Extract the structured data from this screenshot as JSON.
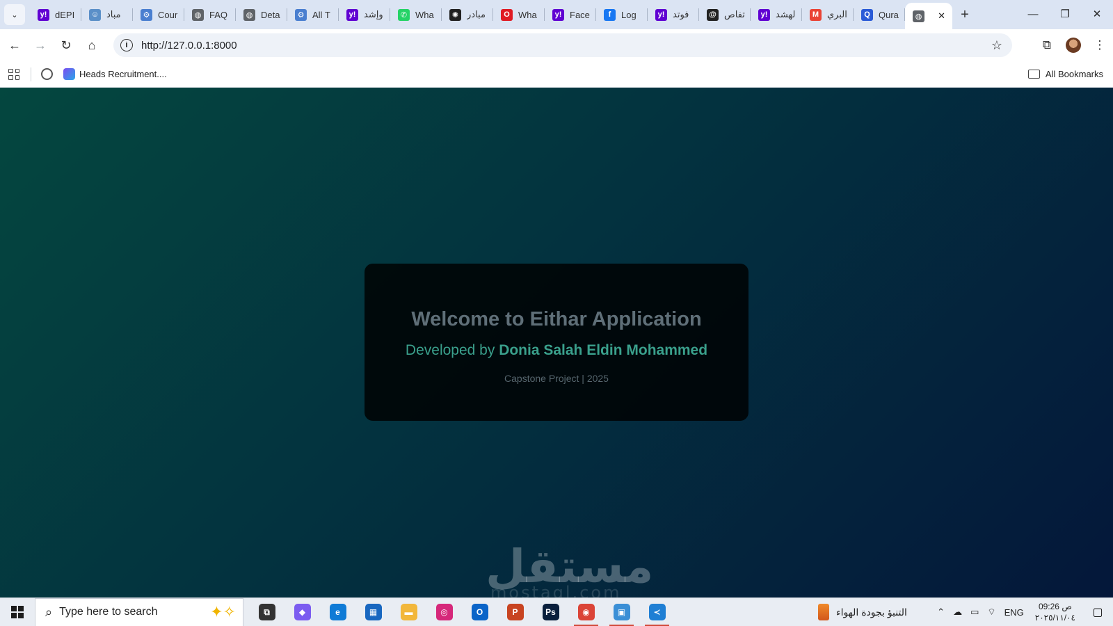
{
  "browser": {
    "tabs": [
      {
        "title": "dEPI",
        "icon": "yahoo-icon",
        "color": "#6001d2",
        "glyph": "y!"
      },
      {
        "title": "مباد",
        "icon": "person-icon",
        "color": "#5a8fc8",
        "glyph": "☺"
      },
      {
        "title": "Cour",
        "icon": "course-icon",
        "color": "#4a7fd0",
        "glyph": "⚙"
      },
      {
        "title": "FAQ",
        "icon": "globe-icon",
        "color": "#5f6368",
        "glyph": "◍"
      },
      {
        "title": "Deta",
        "icon": "globe-icon",
        "color": "#5f6368",
        "glyph": "◍"
      },
      {
        "title": "All T",
        "icon": "course-icon",
        "color": "#4a7fd0",
        "glyph": "⚙"
      },
      {
        "title": "وإشد",
        "icon": "yahoo-icon",
        "color": "#6001d2",
        "glyph": "y!"
      },
      {
        "title": "Wha",
        "icon": "whatsapp-icon",
        "color": "#25d366",
        "glyph": "✆"
      },
      {
        "title": "مبادر",
        "icon": "openai-icon",
        "color": "#222222",
        "glyph": "✺"
      },
      {
        "title": "Wha",
        "icon": "opera-icon",
        "color": "#e01b24",
        "glyph": "O"
      },
      {
        "title": "Face",
        "icon": "yahoo-icon",
        "color": "#6001d2",
        "glyph": "y!"
      },
      {
        "title": "Log",
        "icon": "facebook-icon",
        "color": "#1877f2",
        "glyph": "f"
      },
      {
        "title": "فوتد",
        "icon": "yahoo-icon",
        "color": "#6001d2",
        "glyph": "y!"
      },
      {
        "title": "تفاص",
        "icon": "spiral-icon",
        "color": "#222222",
        "glyph": "@"
      },
      {
        "title": "لهشد",
        "icon": "yahoo-icon",
        "color": "#6001d2",
        "glyph": "y!"
      },
      {
        "title": "البري",
        "icon": "gmail-icon",
        "color": "#ea4335",
        "glyph": "M"
      },
      {
        "title": "Qura",
        "icon": "quora-icon",
        "color": "#2a5bd7",
        "glyph": "Q"
      }
    ],
    "url": "http://127.0.0.1:8000",
    "bookmarks": [
      {
        "title": "Heads Recruitment...."
      }
    ],
    "all_bookmarks_label": "All Bookmarks"
  },
  "page": {
    "heading": "Welcome to Eithar Application",
    "developed_prefix": "Developed by",
    "developer_name": "Donia Salah Eldin Mohammed",
    "footer": "Capstone Project | 2025",
    "bg_gradient": [
      "#04473f",
      "#03323f",
      "#04173a"
    ],
    "accent": "#3aa08c",
    "watermark": "مستقل",
    "watermark_sub": "mostaql.com"
  },
  "taskbar": {
    "search_placeholder": "Type here to search",
    "apps": [
      {
        "name": "task-view-icon",
        "color": "#333333",
        "glyph": "⧉"
      },
      {
        "name": "copilot-icon",
        "color": "#7b5cf0",
        "glyph": "◆"
      },
      {
        "name": "edge-icon",
        "color": "#0f7bd6",
        "glyph": "e"
      },
      {
        "name": "store-icon",
        "color": "#1867c0",
        "glyph": "▦"
      },
      {
        "name": "file-explorer-icon",
        "color": "#f2b73b",
        "glyph": "▬"
      },
      {
        "name": "instagram-icon",
        "color": "#d6287a",
        "glyph": "◎"
      },
      {
        "name": "outlook-icon",
        "color": "#0a64c8",
        "glyph": "O"
      },
      {
        "name": "powerpoint-icon",
        "color": "#c84421",
        "glyph": "P"
      },
      {
        "name": "photoshop-icon",
        "color": "#0a1f3c",
        "glyph": "Ps"
      },
      {
        "name": "chrome-icon",
        "color": "#db4437",
        "glyph": "◉",
        "running": true
      },
      {
        "name": "control-panel-icon",
        "color": "#3a8fd6",
        "glyph": "▣",
        "running": true
      },
      {
        "name": "vscode-icon",
        "color": "#1f7fd4",
        "glyph": "≺",
        "running": true
      }
    ],
    "weather_text": "التنبؤ بجودة الهواء",
    "language": "ENG",
    "time": "09:26 ص",
    "date": "٢٠٢٥/١١/٠٤"
  }
}
